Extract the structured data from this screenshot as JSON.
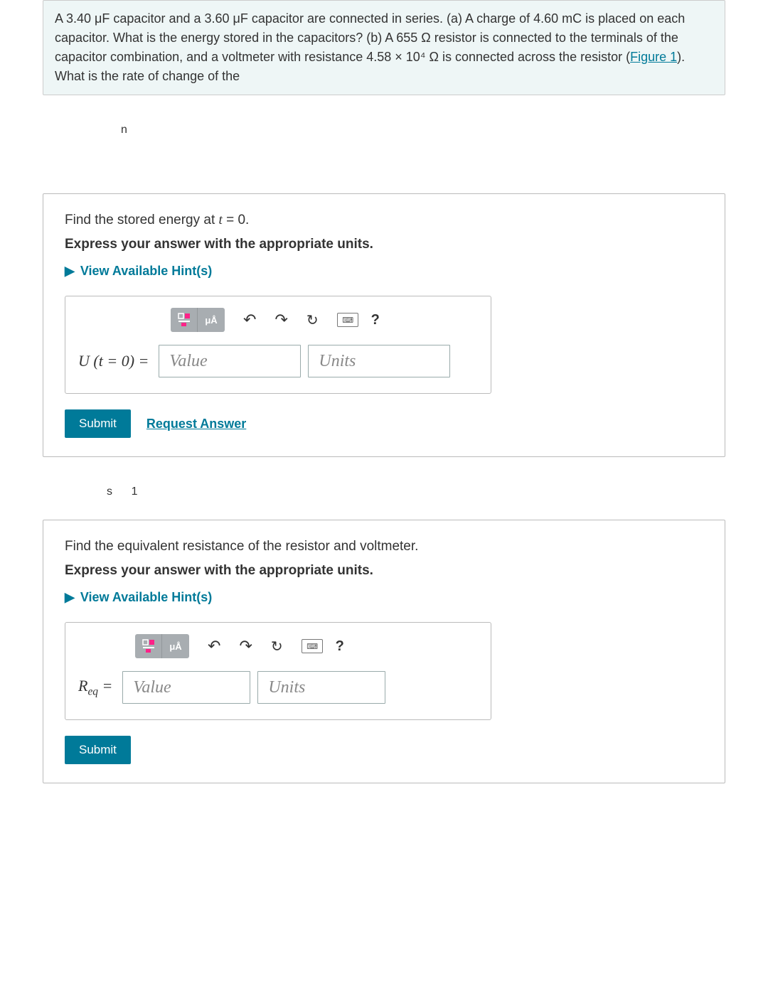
{
  "problem": {
    "text_before_link": "A 3.40 μF capacitor and a 3.60 μF capacitor are connected in series. (a) A charge of 4.60 mC is placed on each capacitor. What is the energy stored in the capacitors? (b) A 655 Ω resistor is connected to the terminals of the capacitor combination, and a voltmeter with resistance 4.58 × 10⁴ Ω is connected across the resistor (",
    "link": "Figure 1",
    "text_after_link": "). What is the rate of change of the"
  },
  "fragment1": "n",
  "part1": {
    "prompt": "Find the stored energy at t = 0.",
    "instruction": "Express your answer with the appropriate units.",
    "hints": "View Available Hint(s)",
    "label_html": "U (t = 0) =",
    "value_placeholder": "Value",
    "units_placeholder": "Units",
    "submit": "Submit",
    "request": "Request Answer"
  },
  "floating": {
    "s": "s",
    "one": "1"
  },
  "tiny": "",
  "part2": {
    "prompt": "Find the equivalent resistance of the resistor and voltmeter.",
    "instruction": "Express your answer with the appropriate units.",
    "hints": "View Available Hint(s)",
    "label": "Req =",
    "label_sub": "eq",
    "value_placeholder": "Value",
    "units_placeholder": "Units",
    "submit": "Submit"
  },
  "toolbar": {
    "ua": "μÅ",
    "question": "?"
  }
}
